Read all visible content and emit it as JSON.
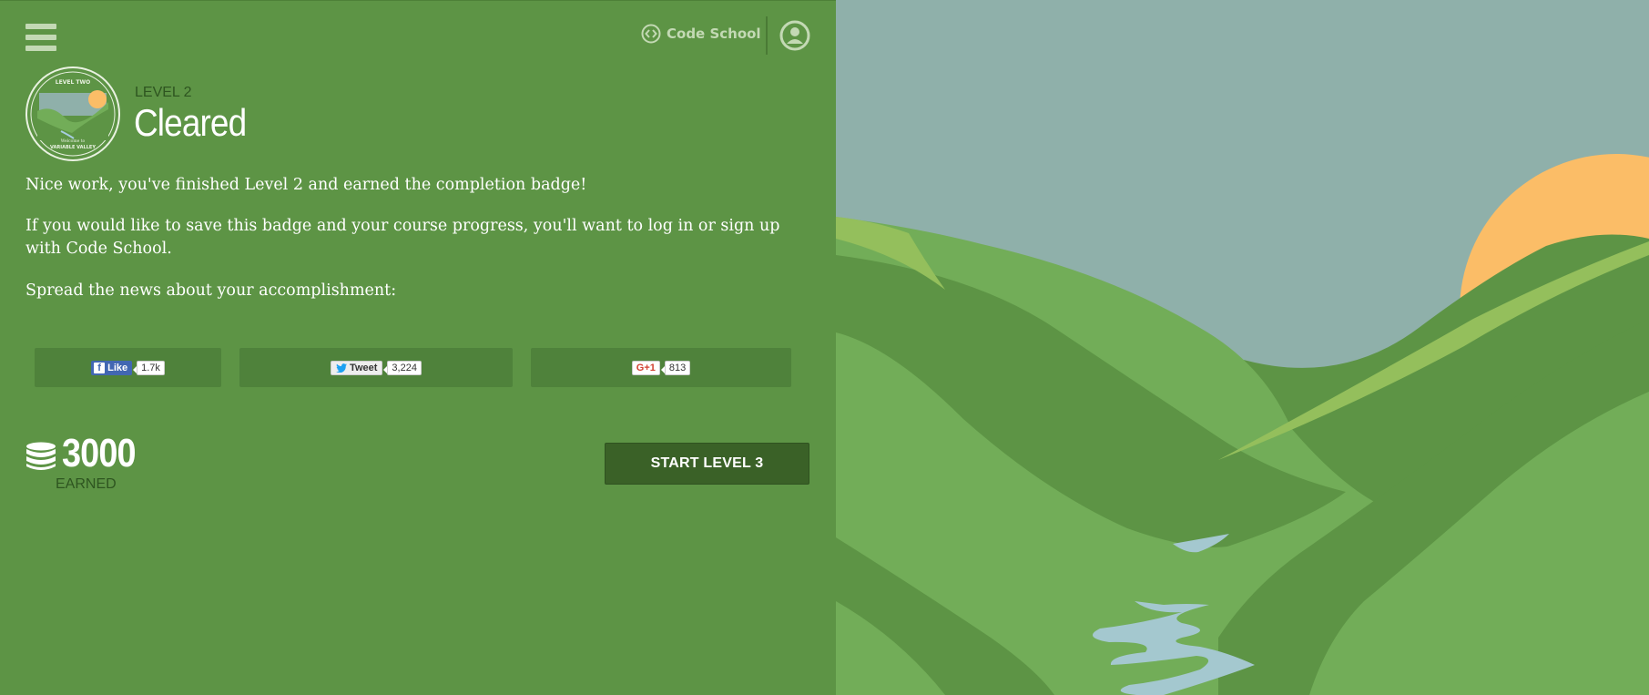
{
  "header": {
    "brand": "Code School",
    "menu_icon": "hamburger-menu-icon",
    "user_icon": "user-avatar-icon"
  },
  "badge": {
    "top_text": "LEVEL TWO",
    "sub_text": "Welcome to",
    "name_text": "VARIABLE VALLEY"
  },
  "level": {
    "label": "LEVEL 2",
    "status": "Cleared"
  },
  "messages": {
    "p1": "Nice work, you've finished Level 2 and earned the completion badge!",
    "p2": "If you would like to save this badge and your course progress, you'll want to log in or sign up with Code School.",
    "p3": "Spread the news about your accomplishment:"
  },
  "share": {
    "facebook": {
      "label": "Like",
      "count": "1.7k"
    },
    "twitter": {
      "label": "Tweet",
      "count": "3,224"
    },
    "google": {
      "label": "G+1",
      "count": "813"
    }
  },
  "points": {
    "value": "3000",
    "label": "EARNED",
    "icon": "coin-stack-icon"
  },
  "actions": {
    "start_label": "START LEVEL 3"
  },
  "colors": {
    "panel": "#5d9445",
    "sky": "#8fb0aa",
    "sun": "#fbbd67",
    "button": "#3a6127"
  }
}
